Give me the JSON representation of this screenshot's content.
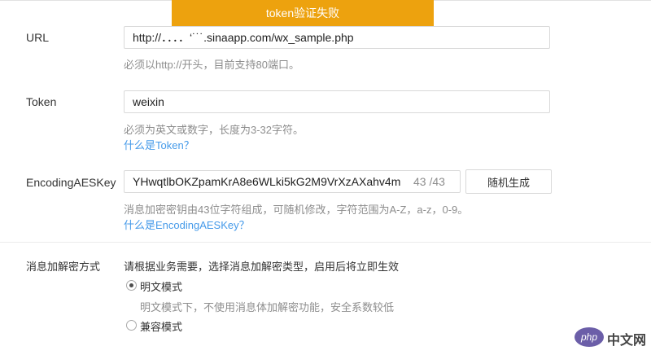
{
  "toast": {
    "text": "token验证失败"
  },
  "url": {
    "label": "URL",
    "value": "http://．．．．‘˙˙˙.sinaapp.com/wx_sample.php",
    "hint": "必须以http://开头，目前支持80端口。"
  },
  "token": {
    "label": "Token",
    "value": "weixin",
    "hint": "必须为英文或数字，长度为3-32字符。",
    "link": "什么是Token？"
  },
  "aeskey": {
    "label": "EncodingAESKey",
    "value": "YHwqtlbOKZpamKrA8e6WLki5kG2M9VrXzAXahv4m",
    "counter": "43 /43",
    "generate_button": "随机生成",
    "hint": "消息加密密钥由43位字符组成，可随机修改，字符范围为A-Z，a-z，0-9。",
    "link": "什么是EncodingAESKey？"
  },
  "encryption": {
    "label": "消息加解密方式",
    "intro": "请根据业务需要，选择消息加解密类型，启用后将立即生效",
    "options": [
      {
        "label": "明文模式",
        "desc": "明文模式下，不使用消息体加解密功能，安全系数较低",
        "checked": true
      },
      {
        "label": "兼容模式",
        "desc": "",
        "checked": false
      }
    ]
  },
  "watermark": {
    "logo": "php",
    "text": "中文网"
  },
  "colors": {
    "toast_bg": "#eda20e",
    "link": "#459ae9",
    "hint": "#8d8d8d"
  }
}
